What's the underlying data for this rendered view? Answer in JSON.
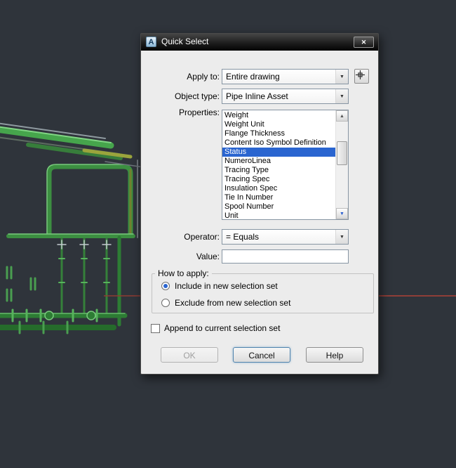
{
  "window": {
    "title": "Quick Select"
  },
  "icons": {
    "app": "A",
    "close": "✕",
    "chevron_down": "▼",
    "arrow_up": "▲",
    "arrow_down": "▼"
  },
  "fields": {
    "apply_to": {
      "label": "Apply to:",
      "value": "Entire drawing"
    },
    "object_type": {
      "label": "Object type:",
      "value": "Pipe Inline Asset"
    },
    "properties": {
      "label": "Properties:",
      "selected_item": "Status",
      "items": [
        "Weight",
        "Weight Unit",
        "Flange Thickness",
        "Content Iso Symbol Definition",
        "Status",
        "NumeroLinea",
        "Tracing Type",
        "Tracing Spec",
        "Insulation Spec",
        "Tie In Number",
        "Spool Number",
        "Unit"
      ]
    },
    "operator": {
      "label": "Operator:",
      "value": "= Equals"
    },
    "value_field": {
      "label": "Value:",
      "value": ""
    }
  },
  "how_to_apply": {
    "label": "How to apply:",
    "options": [
      {
        "label": "Include in new selection set",
        "selected": true
      },
      {
        "label": "Exclude from new selection set",
        "selected": false
      }
    ]
  },
  "append_option": {
    "label": "Append to current selection set",
    "checked": false
  },
  "buttons": {
    "ok": {
      "label": "OK",
      "enabled": false
    },
    "cancel": {
      "label": "Cancel"
    },
    "help": {
      "label": "Help"
    }
  },
  "colors": {
    "selection_blue": "#2a65d0",
    "viewport_bg": "#2f343b",
    "dialog_bg": "#ececec",
    "pipe_green": "#3c8f41",
    "axis_red": "#b04238"
  }
}
